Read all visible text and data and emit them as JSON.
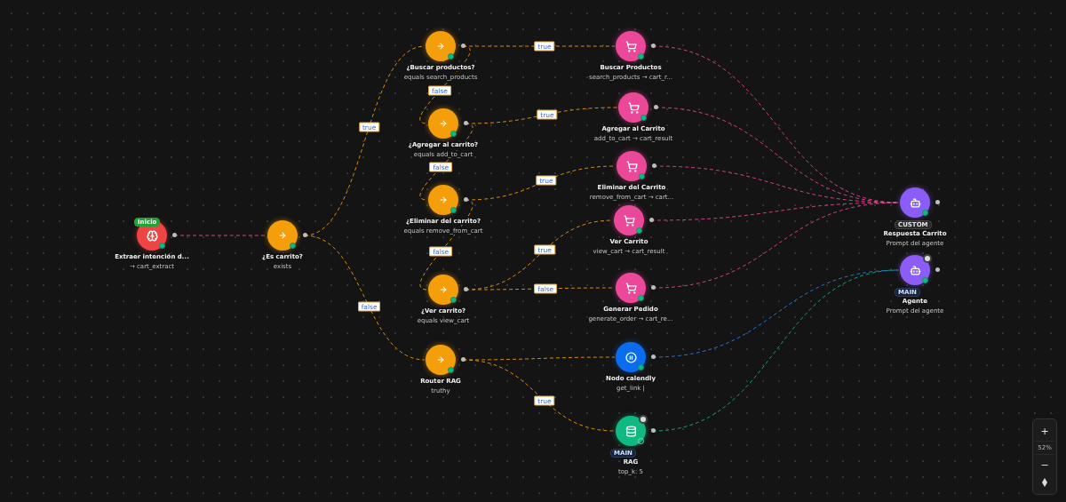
{
  "nodes": [
    {
      "kind": "trigger",
      "title": "Extraer intención d...",
      "subtitle": "→ cart_extract",
      "active": true,
      "pinned": false,
      "badge": {
        "text": "Inicio",
        "kind": "start"
      }
    },
    {
      "kind": "condition",
      "title": "¿Es carrito?",
      "subtitle": "exists",
      "active": true,
      "pinned": false
    },
    {
      "kind": "condition",
      "title": "¿Buscar productos?",
      "subtitle": "equals search_products",
      "active": true,
      "pinned": false
    },
    {
      "kind": "condition",
      "title": "¿Agregar al carrito?",
      "subtitle": "equals add_to_cart",
      "active": true,
      "pinned": false
    },
    {
      "kind": "condition",
      "title": "¿Eliminar del carrito?",
      "subtitle": "equals remove_from_cart",
      "active": true,
      "pinned": false
    },
    {
      "kind": "condition",
      "title": "¿Ver carrito?",
      "subtitle": "equals view_cart",
      "active": true,
      "pinned": false
    },
    {
      "kind": "condition",
      "title": "Router RAG",
      "subtitle": "truthy",
      "active": true,
      "pinned": false
    },
    {
      "kind": "action",
      "title": "Buscar Productos",
      "subtitle": "search_products → cart_r...",
      "active": true,
      "pinned": false
    },
    {
      "kind": "action",
      "title": "Agregar al Carrito",
      "subtitle": "add_to_cart → cart_result",
      "active": true,
      "pinned": false
    },
    {
      "kind": "action",
      "title": "Eliminar del Carrito",
      "subtitle": "remove_from_cart → cart...",
      "active": true,
      "pinned": false
    },
    {
      "kind": "action",
      "title": "Ver Carrito",
      "subtitle": "view_cart → cart_result",
      "active": true,
      "pinned": false
    },
    {
      "kind": "action",
      "title": "Generar Pedido",
      "subtitle": "generate_order → cart_re...",
      "active": true,
      "pinned": false
    },
    {
      "kind": "calendly",
      "title": "Nodo calendly",
      "subtitle": "get_link |",
      "active": true,
      "pinned": false
    },
    {
      "kind": "rag",
      "title": "RAG",
      "subtitle": "top_k: 5",
      "active": false,
      "pinned": true,
      "badge": {
        "text": "MAIN",
        "kind": "main"
      }
    },
    {
      "kind": "agent",
      "title": "Respuesta Carrito",
      "subtitle": "Prompt del agente",
      "active": true,
      "pinned": false,
      "badge": {
        "text": "CUSTOM",
        "kind": "custom"
      }
    },
    {
      "kind": "agent",
      "title": "Agente",
      "subtitle": "Prompt del agente",
      "active": true,
      "pinned": true,
      "badge": {
        "text": "MAIN",
        "kind": "main"
      }
    }
  ],
  "edge_labels": [
    "true",
    "false",
    "true",
    "false",
    "true",
    "false",
    "true",
    "false",
    "true",
    "false",
    "true"
  ],
  "zoom": {
    "in": "+",
    "level": "52%",
    "out": "−"
  }
}
